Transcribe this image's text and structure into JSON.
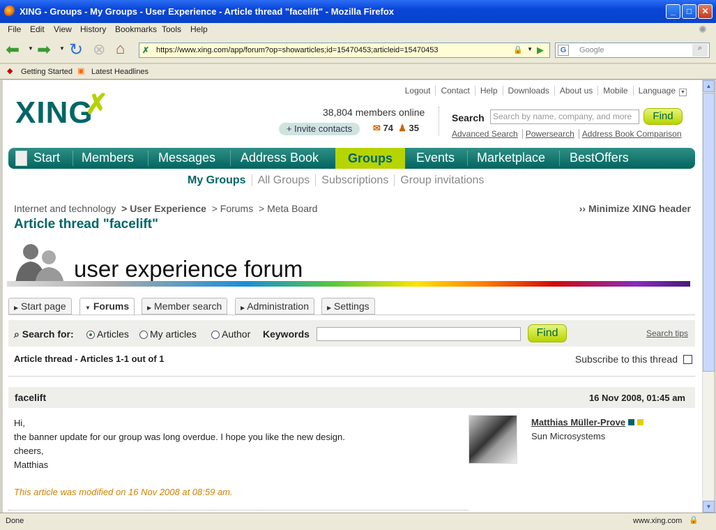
{
  "window": {
    "title": "XING - Groups - My Groups - User Experience - Article thread \"facelift\" - Mozilla Firefox"
  },
  "menu": [
    "File",
    "Edit",
    "View",
    "History",
    "Bookmarks",
    "Tools",
    "Help"
  ],
  "browser": {
    "url": "https://www.xing.com/app/forum?op=showarticles;id=15470453;articleid=15470453",
    "search_placeholder": "Google"
  },
  "bookmarks": [
    "Getting Started",
    "Latest Headlines"
  ],
  "header": {
    "toplinks": [
      "Logout",
      "Contact",
      "Help",
      "Downloads",
      "About us",
      "Mobile",
      "Language"
    ],
    "logo": "XING",
    "members_online": "38,804 members online",
    "invite": "+ Invite contacts",
    "messages_count": "74",
    "contacts_count": "35",
    "search_label": "Search",
    "search_placeholder": "Search by name, company, and more",
    "find": "Find",
    "advanced": [
      "Advanced Search",
      "Powersearch",
      "Address Book Comparison"
    ]
  },
  "mainnav": [
    "Start",
    "Members",
    "Messages",
    "Address Book",
    "Groups",
    "Events",
    "Marketplace",
    "BestOffers"
  ],
  "subnav": [
    "My Groups",
    "All Groups",
    "Subscriptions",
    "Group invitations"
  ],
  "breadcrumbs": {
    "c1": "Internet and technology",
    "c2": "> User Experience",
    "c3": "> Forums",
    "c4": "> Meta Board",
    "minimize": "›› Minimize XING header"
  },
  "page_title": "Article thread \"facelift\"",
  "banner_text": "user experience forum",
  "tabs": [
    "Start page",
    "Forums",
    "Member search",
    "Administration",
    "Settings"
  ],
  "forum_search": {
    "label": "Search for:",
    "options": [
      "Articles",
      "My articles",
      "Author"
    ],
    "keywords": "Keywords",
    "find": "Find",
    "tips": "Search tips"
  },
  "thread": {
    "count": "Article thread - Articles 1-1 out of 1",
    "subscribe": "Subscribe to this thread"
  },
  "post": {
    "subject": "facelift",
    "date": "16 Nov 2008, 01:45 am",
    "lines": [
      "Hi,",
      "the banner update for our group was long overdue. I hope you like the new design.",
      "cheers,",
      "Matthias"
    ],
    "modified": "This article was modified on 16 Nov 2008 at 08:59 am.",
    "author": "Matthias Müller-Prove",
    "company": "Sun Microsystems"
  },
  "status": {
    "left": "Done",
    "right": "www.xing.com"
  }
}
